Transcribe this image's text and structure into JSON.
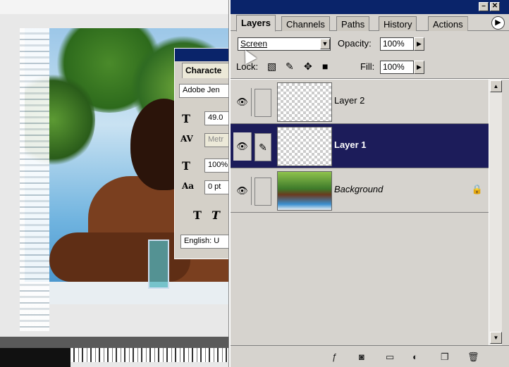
{
  "layers_panel": {
    "tabs": [
      {
        "label": "Layers",
        "active": true
      },
      {
        "label": "Channels",
        "active": false
      },
      {
        "label": "Paths",
        "active": false
      },
      {
        "label": "History",
        "active": false
      },
      {
        "label": "Actions",
        "active": false
      }
    ],
    "blend_mode": "Screen",
    "opacity_label": "Opacity:",
    "opacity_value": "100%",
    "lock_label": "Lock:",
    "fill_label": "Fill:",
    "fill_value": "100%",
    "layers": [
      {
        "name": "Layer 2",
        "visible": true,
        "selected": false,
        "locked": false
      },
      {
        "name": "Layer 1",
        "visible": true,
        "selected": true,
        "locked": false
      },
      {
        "name": "Background",
        "visible": true,
        "selected": false,
        "locked": true
      }
    ]
  },
  "character_panel": {
    "tab_label": "Characte",
    "font_family": "Adobe Jen",
    "font_size": "49.0",
    "kerning": "Metr",
    "vertical_scale": "100%",
    "baseline_shift": "0 pt",
    "language": "English: U"
  },
  "icons": {
    "eye": "eye-icon",
    "brush": "brush-icon",
    "lock": "lock-icon",
    "palette_menu": "arrow-right-icon"
  },
  "colors": {
    "title_bar": "#0a246a",
    "selected_row": "#1c1c5a",
    "panel_bg": "#d6d3ce"
  }
}
